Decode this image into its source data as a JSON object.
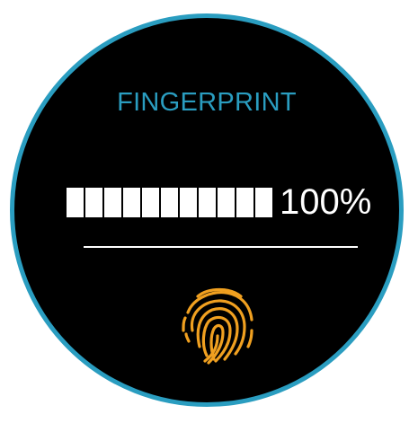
{
  "screen": {
    "title": "FINGERPRINT",
    "progress": {
      "value_percent": 100,
      "label": "100%",
      "segments_total": 11,
      "segments_filled": 11
    },
    "icon": "fingerprint-icon"
  },
  "colors": {
    "accent": "#2a9dc0",
    "icon": "#f0a020",
    "background": "#000000",
    "foreground": "#ffffff"
  }
}
